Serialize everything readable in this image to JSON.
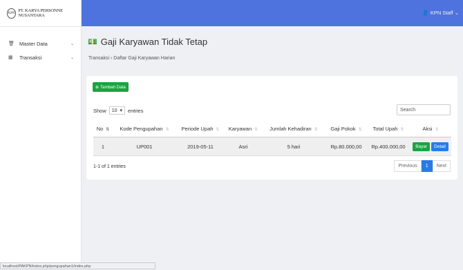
{
  "brand": {
    "logo": "KPN",
    "name": "PT. KARYA PERSONNE NUSANTARA"
  },
  "sidebar": {
    "items": [
      {
        "label": "Master Data",
        "icon": "trash-icon"
      },
      {
        "label": "Transaksi",
        "icon": "table-icon"
      }
    ]
  },
  "topbar": {
    "user": "KPN Staff"
  },
  "page": {
    "title": "Gaji Karyawan Tidak Tetap",
    "breadcrumb": "Transaksi › Daftar Gaji Karyawan Harian"
  },
  "controls": {
    "add_label": "Tambah Data",
    "show": "Show",
    "entries_value": "10",
    "entries": "entries",
    "search_placeholder": "Search"
  },
  "table": {
    "columns": [
      "No",
      "Kode Pengupahan",
      "Periode Upah",
      "Karyawan",
      "Jumlah Kehadiran",
      "Gaji Pokok",
      "Total Upah",
      "Aksi"
    ],
    "rows": [
      {
        "no": "1",
        "kode": "UP001",
        "periode": "2019-05-11",
        "karyawan": "Asri",
        "kehadiran": "5 hari",
        "gaji": "Rp.80.000,00",
        "total": "Rp.400.000,00"
      }
    ],
    "actions": {
      "bayar": "Bayar",
      "detail": "Detail"
    }
  },
  "footer": {
    "info": "1-1 of 1 entries",
    "previous": "Previous",
    "page": "1",
    "next": "Next"
  },
  "status_url": "localhost/PAKPN/index.php/pengupahan1/index.php"
}
